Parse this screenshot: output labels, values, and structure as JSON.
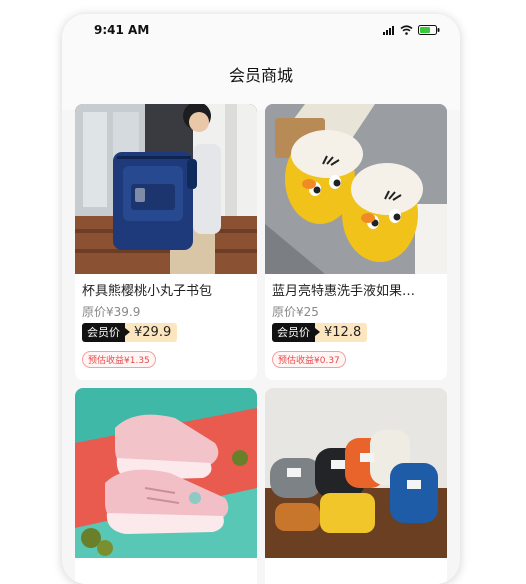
{
  "status": {
    "time": "9:41 AM"
  },
  "page": {
    "title": "会员商城"
  },
  "products": [
    {
      "name": "杯具熊樱桃小丸子书包",
      "original_price": "原价¥39.9",
      "member_tag": "会员价",
      "member_price": "¥29.9",
      "earnings": "预估收益¥1.35"
    },
    {
      "name": "蓝月亮特惠洗手液如果…",
      "original_price": "原价¥25",
      "member_tag": "会员价",
      "member_price": "¥12.8",
      "earnings": "预估收益¥0.37"
    }
  ],
  "colors": {
    "member_tag_bg": "#111111",
    "member_price_bg": "#fbe6c0",
    "earnings_red": "#e64a4a"
  }
}
